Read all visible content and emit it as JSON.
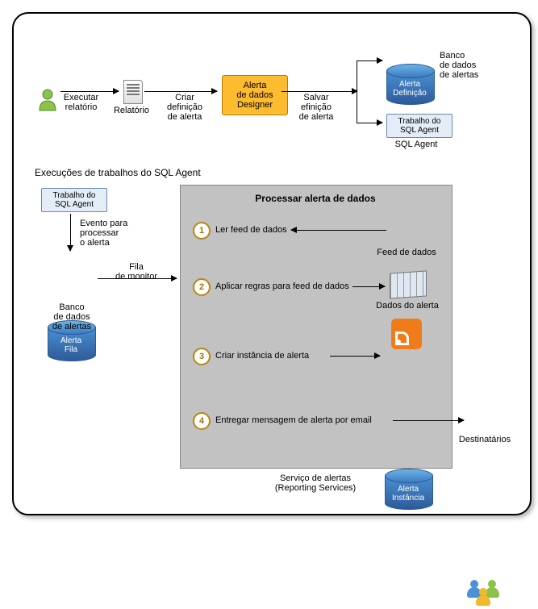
{
  "top": {
    "executar": "Executar\nrelatório",
    "relatorio": "Relatório",
    "criar": "Criar\ndefinição\nde alerta",
    "designer": "Alerta\nde dados\nDesigner",
    "salvar": "Salvar\nefinição\nde alerta",
    "db_def": "Alerta\nDefinição",
    "db_def_side": "Banco\nde dados\nde alertas",
    "sql_job": "Trabalho do\nSQL Agent",
    "sql_agent": "SQL Agent"
  },
  "section_title": "Execuções de trabalhos do SQL Agent",
  "left": {
    "sql_job": "Trabalho do\nSQL Agent",
    "evento": "Evento para\nprocessar\no alerta",
    "db_fila": "Alerta\nFila",
    "db_fila_below": "Banco\nde dados\nde alertas",
    "fila": "Fila\nde monitor"
  },
  "panel": {
    "title": "Processar alerta de dados",
    "step1": "Ler feed de dados",
    "feed": "Feed de dados",
    "step2": "Aplicar regras para feed de dados",
    "dados": "Dados do alerta",
    "step3": "Criar instância de alerta",
    "db_inst": "Alerta\nInstância",
    "step4": "Entregar mensagem de alerta por email",
    "dest": "Destinatários"
  },
  "footer": "Serviço de alertas\n(Reporting Services)",
  "nums": {
    "1": "1",
    "2": "2",
    "3": "3",
    "4": "4"
  }
}
